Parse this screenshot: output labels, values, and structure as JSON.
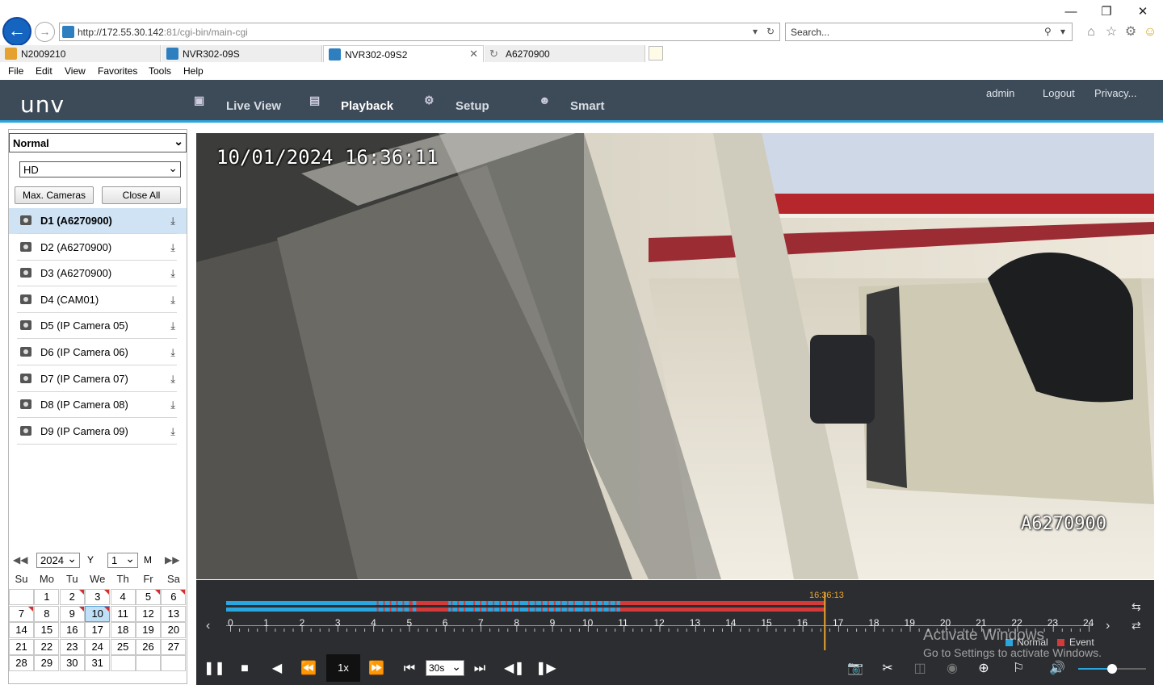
{
  "browser": {
    "url": "http://172.55.30.142",
    "url_port_path": ":81/cgi-bin/main-cgi",
    "search_placeholder": "Search...",
    "tabs": [
      {
        "label": "N2009210",
        "active": false
      },
      {
        "label": "NVR302-09S",
        "active": false
      },
      {
        "label": "NVR302-09S2",
        "active": true
      },
      {
        "label": "A6270900",
        "active": false
      }
    ],
    "menu": [
      "File",
      "Edit",
      "View",
      "Favorites",
      "Tools",
      "Help"
    ]
  },
  "header": {
    "logo": "unv",
    "nav": [
      {
        "label": "Live View",
        "icon": "monitor-icon"
      },
      {
        "label": "Playback",
        "icon": "film-icon",
        "active": true
      },
      {
        "label": "Setup",
        "icon": "gear-icon"
      },
      {
        "label": "Smart",
        "icon": "person-icon"
      }
    ],
    "user": "admin",
    "logout": "Logout",
    "privacy": "Privacy..."
  },
  "left": {
    "mode": "Normal",
    "stream": "HD",
    "max_cameras": "Max. Cameras",
    "close_all": "Close All",
    "cameras": [
      "D1 (A6270900)",
      "D2 (A6270900)",
      "D3 (A6270900)",
      "D4 (CAM01)",
      "D5 (IP Camera 05)",
      "D6 (IP Camera 06)",
      "D7 (IP Camera 07)",
      "D8 (IP Camera 08)",
      "D9 (IP Camera 09)"
    ],
    "selected_camera": 0
  },
  "calendar": {
    "year": "2024",
    "year_unit": "Y",
    "month": "1",
    "month_unit": "M",
    "weekdays": [
      "Su",
      "Mo",
      "Tu",
      "We",
      "Th",
      "Fr",
      "Sa"
    ],
    "today": 10,
    "first_weekday": 1,
    "days_in_month": 31
  },
  "video": {
    "osd_time": "10/01/2024 16:36:11",
    "osd_camera": "A6270900"
  },
  "timeline": {
    "current_time": "16:36:13",
    "hours": [
      "0",
      "1",
      "2",
      "3",
      "4",
      "5",
      "6",
      "7",
      "8",
      "9",
      "10",
      "11",
      "12",
      "13",
      "14",
      "15",
      "16",
      "17",
      "18",
      "19",
      "20",
      "21",
      "22",
      "23",
      "24"
    ],
    "legend_normal": "Normal",
    "legend_event": "Event",
    "colors": {
      "normal": "#2aa6df",
      "event": "#d33b3b"
    }
  },
  "controls": {
    "speed": "1x",
    "interval": "30s"
  },
  "watermark": {
    "line1": "Activate Windows",
    "line2": "Go to Settings to activate Windows."
  }
}
